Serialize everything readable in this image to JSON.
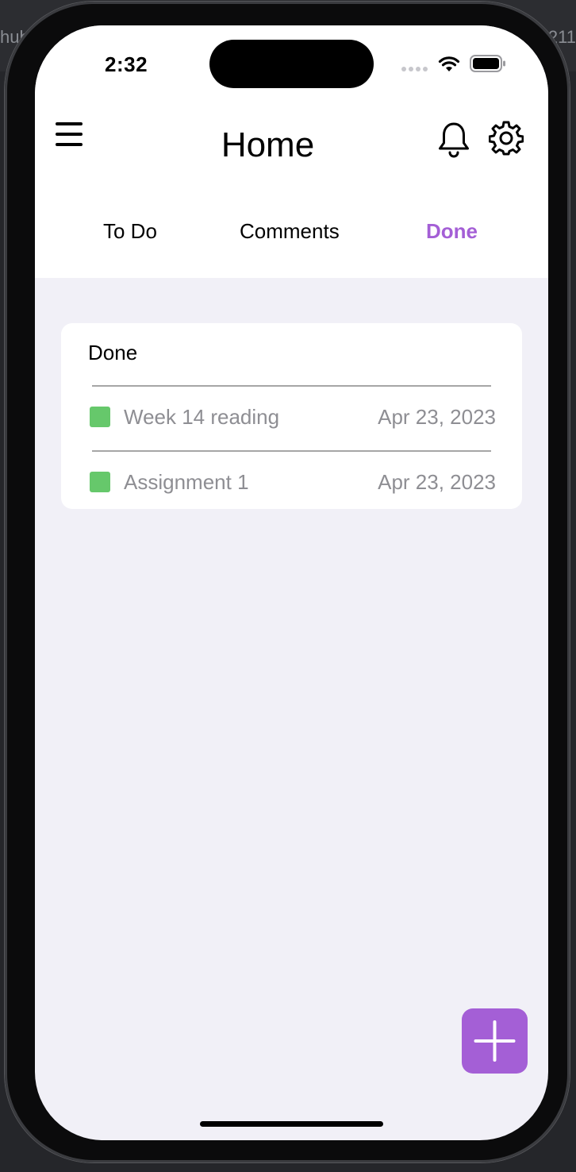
{
  "background": {
    "left_fragment": "hub",
    "right_fragment": "211"
  },
  "status_bar": {
    "time": "2:32",
    "icons": [
      "cellular-signal-icon",
      "wifi-icon",
      "battery-icon"
    ]
  },
  "header": {
    "title": "Home",
    "icons": [
      "menu-icon",
      "bell-icon",
      "gear-icon"
    ]
  },
  "tabs": [
    {
      "label": "To Do",
      "active": false
    },
    {
      "label": "Comments",
      "active": false
    },
    {
      "label": "Done",
      "active": true
    }
  ],
  "card": {
    "title": "Done",
    "items": [
      {
        "name": "Week 14 reading",
        "date": "Apr 23, 2023",
        "status_color": "#66c86b"
      },
      {
        "name": "Assignment 1",
        "date": "Apr 23, 2023",
        "status_color": "#66c86b"
      }
    ]
  },
  "fab": {
    "icon": "plus-icon"
  },
  "colors": {
    "accent": "#a45fd6",
    "done_green": "#66c86b",
    "screen_background": "#f1f0f7",
    "muted_text": "#8e8e93"
  }
}
